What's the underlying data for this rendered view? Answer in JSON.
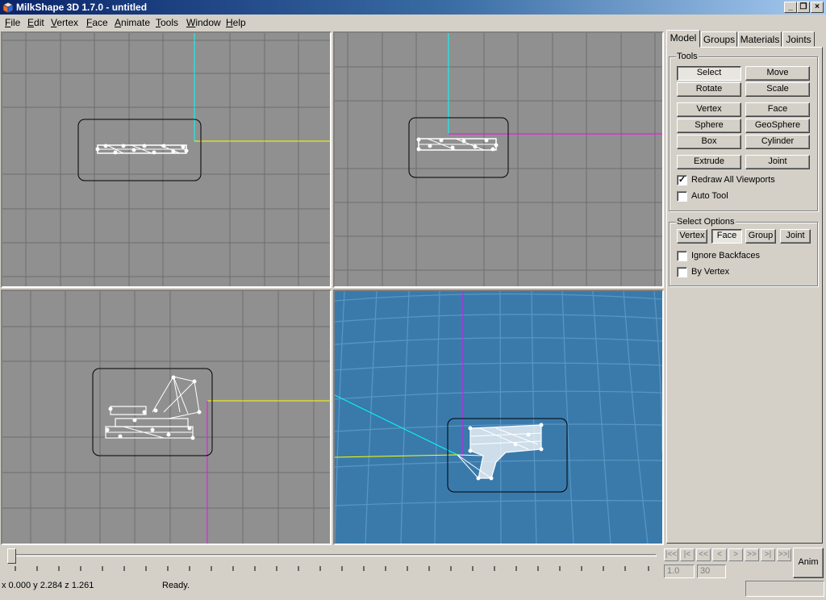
{
  "window": {
    "title": "MilkShape 3D 1.7.0 - untitled"
  },
  "menu": [
    {
      "label": "File",
      "key": "F",
      "rest": "ile"
    },
    {
      "label": "Edit",
      "key": "E",
      "rest": "dit"
    },
    {
      "label": "Vertex",
      "key": "V",
      "rest": "ertex"
    },
    {
      "label": "Face",
      "key": "F",
      "rest": "ace"
    },
    {
      "label": "Animate",
      "key": "A",
      "rest": "nimate"
    },
    {
      "label": "Tools",
      "key": "T",
      "rest": "ools"
    },
    {
      "label": "Window",
      "key": "W",
      "rest": "indow"
    },
    {
      "label": "Help",
      "key": "H",
      "rest": "elp"
    }
  ],
  "tabs": [
    "Model",
    "Groups",
    "Materials",
    "Joints"
  ],
  "tools": {
    "group_title": "Tools",
    "buttons": [
      "Select",
      "Move",
      "Rotate",
      "Scale",
      "Vertex",
      "Face",
      "Sphere",
      "GeoSphere",
      "Box",
      "Cylinder",
      "Extrude",
      "Joint"
    ],
    "active": "Select",
    "checks": [
      {
        "label": "Redraw All Viewports",
        "checked": true
      },
      {
        "label": "Auto Tool",
        "checked": false
      }
    ]
  },
  "select_options": {
    "group_title": "Select Options",
    "buttons": [
      "Vertex",
      "Face",
      "Group",
      "Joint"
    ],
    "active": "Face",
    "checks": [
      {
        "label": "Ignore Backfaces",
        "checked": false
      },
      {
        "label": "By Vertex",
        "checked": false
      }
    ]
  },
  "animation": {
    "nav_glyphs": [
      "|<<",
      "|<",
      "<<",
      "<",
      ">",
      ">>",
      ">|",
      ">>|"
    ],
    "frame_current": "1.0",
    "frame_total": "30",
    "anim_button": "Anim"
  },
  "status": {
    "coords": "x 0.000 y 2.284 z 1.261",
    "message": "Ready."
  },
  "colors": {
    "viewport_bg": "#909090",
    "perspective_bg": "#3a7aab",
    "axis_x": "#ffff00",
    "axis_y": "#00ffff",
    "axis_z": "#ff00ff",
    "title_start": "#0a246a"
  }
}
